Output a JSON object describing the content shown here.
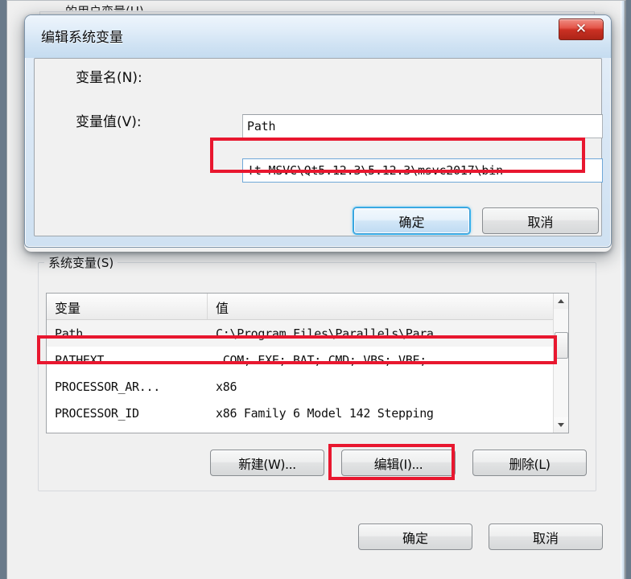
{
  "background_window": {
    "user_variables_label": "…的用户变量(U)",
    "system_variables_group_label": "系统变量(S)",
    "list": {
      "columns": [
        "变量",
        "值"
      ],
      "rows": [
        {
          "variable": "Path",
          "value": "C:\\Program Files\\Parallels\\Para...",
          "selected": true
        },
        {
          "variable": "PATHEXT",
          "value": ".COM;.EXE;.BAT;.CMD;.VBS;.VBE;....",
          "selected": false
        },
        {
          "variable": "PROCESSOR_AR...",
          "value": "x86",
          "selected": false
        },
        {
          "variable": "PROCESSOR_ID",
          "value": "x86 Family 6 Model 142 Stepping",
          "selected": false
        }
      ],
      "scrollbar": {
        "up_arrow": "▲",
        "down_arrow": "▼"
      }
    },
    "buttons": {
      "new": "新建(W)...",
      "edit": "编辑(I)...",
      "delete": "删除(L)",
      "ok": "确定",
      "cancel": "取消"
    }
  },
  "modal_dialog": {
    "title": "编辑系统变量",
    "close_label": "✕",
    "fields": {
      "name_label": "变量名(N):",
      "name_value": "Path",
      "value_label": "变量值(V):",
      "value_value": "!t-MSVC\\Qt5.12.3\\5.12.3\\msvc2017\\bin"
    },
    "buttons": {
      "ok": "确定",
      "cancel": "取消"
    }
  },
  "annotations": {
    "accent_color": "#e8172f",
    "highlighted": [
      "variable-value-input",
      "path-list-row",
      "edit-button"
    ]
  }
}
